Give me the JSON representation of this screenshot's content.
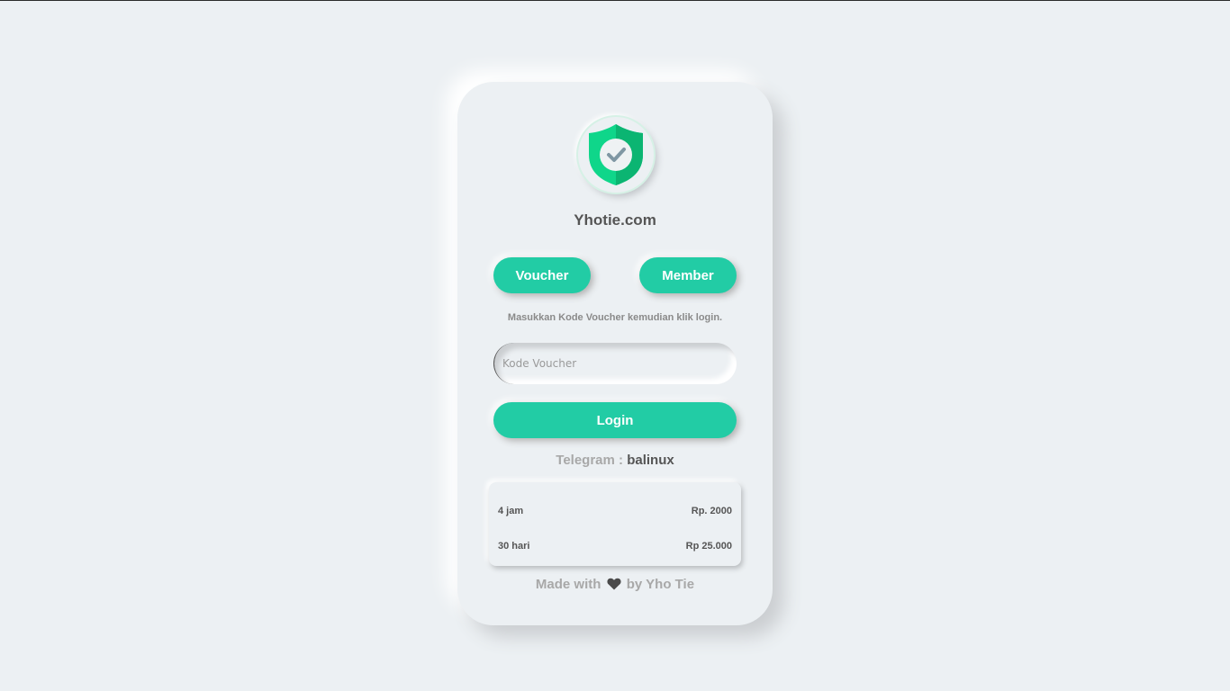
{
  "brand": {
    "title": "Yhotie.com",
    "accent_color": "#22cca5"
  },
  "tabs": {
    "voucher_label": "Voucher",
    "member_label": "Member"
  },
  "form": {
    "instruction": "Masukkan Kode Voucher kemudian klik login.",
    "voucher_placeholder": "Kode Voucher",
    "voucher_value": "",
    "login_label": "Login"
  },
  "contact": {
    "label": "Telegram : ",
    "handle": "balinux"
  },
  "prices": [
    {
      "duration": "4 jam",
      "price": "Rp. 2000"
    },
    {
      "duration": "30 hari",
      "price": "Rp 25.000"
    }
  ],
  "footer": {
    "prefix": "Made with",
    "icon": "heart-icon",
    "suffix": "by Yho Tie"
  }
}
